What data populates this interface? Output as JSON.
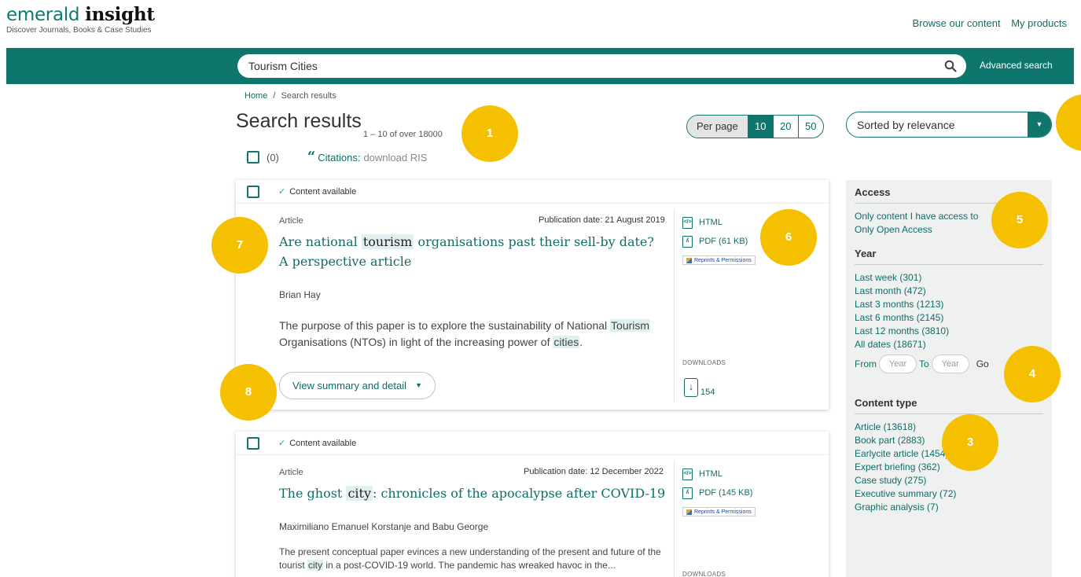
{
  "header": {
    "logo_light": "emerald",
    "logo_bold": "insight",
    "tagline": "Discover Journals, Books & Case Studies",
    "links": [
      "Browse our content",
      "My products"
    ]
  },
  "search": {
    "value": "Tourism Cities",
    "advanced_label": "Advanced search"
  },
  "breadcrumb": {
    "home": "Home",
    "sep": "/",
    "current": "Search results"
  },
  "results": {
    "title": "Search results",
    "count_text": "1 – 10 of over 18000",
    "selected_count": "(0)",
    "citations_label": "Citations:",
    "citations_action": "download RIS"
  },
  "per_page": {
    "label": "Per page",
    "options": [
      "10",
      "20",
      "50"
    ],
    "selected": "10"
  },
  "sort": {
    "selected": "Sorted by relevance"
  },
  "cards": [
    {
      "availability": "Content available",
      "type": "Article",
      "pub_date": "Publication date: 21 August 2019",
      "title_pre": "Are national ",
      "title_hl": "tourism",
      "title_post": " organisations past their sell-by date? A perspective article",
      "authors": "Brian Hay",
      "abstract_1": "The purpose of this paper is to explore the sustainability of National ",
      "abstract_hl1": "Tourism",
      "abstract_2": " Organisations (NTOs) in light of the increasing power of ",
      "abstract_hl2": "cities",
      "abstract_3": ".",
      "html_label": "HTML",
      "pdf_label": "PDF (61 KB)",
      "reprints_label": "Reprints & Permissions",
      "downloads_label": "DOWNLOADS",
      "downloads_count": "154",
      "summary_button": "View summary and detail"
    },
    {
      "availability": "Content available",
      "type": "Article",
      "pub_date": "Publication date: 12 December 2022",
      "title_pre": "The ghost ",
      "title_hl": "city",
      "title_post": ": chronicles of the apocalypse after COVID-19",
      "authors": "Maximiliano Emanuel Korstanje and Babu George",
      "abstract_1": "The present conceptual paper evinces a new understanding of the present and future of the tourist ",
      "abstract_hl1": "city",
      "abstract_2": " in a post-COVID-19 world. The pandemic has wreaked havoc in the...",
      "html_label": "HTML",
      "pdf_label": "PDF (145 KB)",
      "reprints_label": "Reprints & Permissions",
      "downloads_label": "DOWNLOADS"
    }
  ],
  "sidebar": {
    "access_title": "Access",
    "access_items": [
      "Only content I have access to",
      "Only Open Access"
    ],
    "year_title": "Year",
    "year_items": [
      "Last week (301)",
      "Last month (472)",
      "Last 3 months (1213)",
      "Last 6 months (2145)",
      "Last 12 months (3810)",
      "All dates (18671)"
    ],
    "year_from": "From",
    "year_to": "To",
    "year_placeholder": "Year",
    "year_go": "Go",
    "content_title": "Content type",
    "content_items": [
      "Article (13618)",
      "Book part (2883)",
      "Earlycite article (1454)",
      "Expert briefing (362)",
      "Case study (275)",
      "Executive summary (72)",
      "Graphic analysis (7)"
    ]
  },
  "badges": [
    "1",
    "3",
    "4",
    "5",
    "6",
    "7",
    "8"
  ],
  "colors": {
    "brand": "#0f766e",
    "badge": "#f5c000",
    "link": "#0e6e66"
  }
}
